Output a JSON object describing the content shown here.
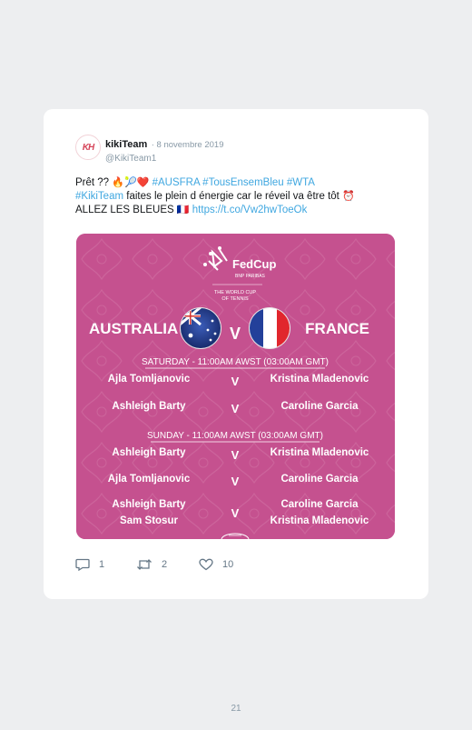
{
  "tweet": {
    "avatar_text": "KH",
    "display_name": "kikiTeam",
    "date": "· 8 novembre 2019",
    "handle": "@KikiTeam1",
    "text": {
      "prefix": "Prêt ?? ",
      "emojis1": "🔥🎾❤️",
      "hashtags1": " #AUSFRA #TousEnsemBleu #WTA",
      "hashtag2": "#KikiTeam",
      "middle": " faites le plein d énergie car le réveil va être tôt ",
      "alarm": "⏰",
      "line3": "ALLEZ LES BLEUES ",
      "flag": "🇫🇷",
      "link": "https://t.co/Vw2hwToeOk"
    }
  },
  "graphic": {
    "brand": "FedCup",
    "sponsor": "BNP PARIBAS",
    "tagline1": "THE WORLD CUP",
    "tagline2": "OF TENNIS",
    "team_left": "AUSTRALIA",
    "team_right": "FRANCE",
    "versus": "V",
    "saturday_header": "SATURDAY - 11:00AM AWST (03:00AM GMT)",
    "sunday_header": "SUNDAY - 11:00AM AWST (03:00AM GMT)",
    "saturday_matches": [
      {
        "left": "Ajla Tomljanovic",
        "right": "Kristina Mladenovic"
      },
      {
        "left": "Ashleigh Barty",
        "right": "Caroline Garcia"
      }
    ],
    "sunday_matches": [
      {
        "left": "Ashleigh Barty",
        "right": "Kristina Mladenovic"
      },
      {
        "left": "Ajla Tomljanovic",
        "right": "Caroline Garcia"
      }
    ],
    "doubles": {
      "left1": "Ashleigh Barty",
      "left2": "Sam Stosur",
      "right1": "Caroline Garcia",
      "right2": "Kristina Mladenovic"
    },
    "colors": {
      "background": "#c5518f",
      "pattern": "#d173a5",
      "text": "#ffffff"
    }
  },
  "actions": {
    "replies": "1",
    "retweets": "2",
    "likes": "10"
  },
  "icons": [
    "reply-icon",
    "retweet-icon",
    "heart-icon"
  ],
  "page_number": "21"
}
